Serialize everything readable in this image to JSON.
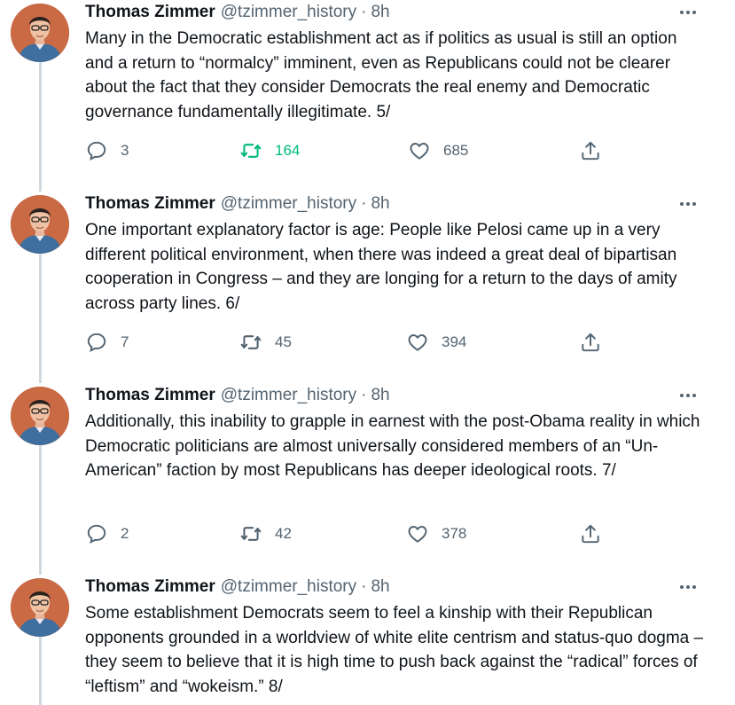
{
  "tweets": [
    {
      "author": "Thomas Zimmer",
      "handle": "@tzimmer_history",
      "separator": "·",
      "time": "8h",
      "text": "Many in the Democratic establishment act as if politics as usual is still an option and a return to “normalcy” imminent, even as Republicans could not be clearer about the fact that they consider Democrats the real enemy and Democratic governance fundamentally illegitimate. 5/",
      "replies": "3",
      "retweets": "164",
      "likes": "685",
      "retweeted": true
    },
    {
      "author": "Thomas Zimmer",
      "handle": "@tzimmer_history",
      "separator": "·",
      "time": "8h",
      "text": "One important explanatory factor is age: People like Pelosi came up in a very different political environment, when there was indeed a great deal of bipartisan cooperation in Congress – and they are longing for a return to the days of amity across party lines. 6/",
      "replies": "7",
      "retweets": "45",
      "likes": "394",
      "retweeted": false
    },
    {
      "author": "Thomas Zimmer",
      "handle": "@tzimmer_history",
      "separator": "·",
      "time": "8h",
      "text": "Additionally, this inability to grapple in earnest with the post-Obama reality in which Democratic politicians are almost universally considered members of an “Un-American” faction by most Republicans has deeper ideological roots. 7/",
      "replies": "2",
      "retweets": "42",
      "likes": "378",
      "retweeted": false
    },
    {
      "author": "Thomas Zimmer",
      "handle": "@tzimmer_history",
      "separator": "·",
      "time": "8h",
      "text": "Some establishment Democrats seem to feel a kinship with their Republican opponents grounded in a worldview of white elite centrism and status-quo dogma – they seem to believe that it is high time to push back against the “radical” forces of “leftism” and “wokeism.” 8/",
      "replies": "",
      "retweets": "",
      "likes": "",
      "retweeted": false
    }
  ],
  "icons": {
    "reply": "reply-icon",
    "retweet": "retweet-icon",
    "like": "heart-icon",
    "share": "share-icon",
    "more": "more-options-icon"
  },
  "colors": {
    "text": "#0f1419",
    "secondary": "#536471",
    "retweet_active": "#00ba7c",
    "thread_line": "#cfd9de",
    "avatar_bg": "#c96a45"
  }
}
